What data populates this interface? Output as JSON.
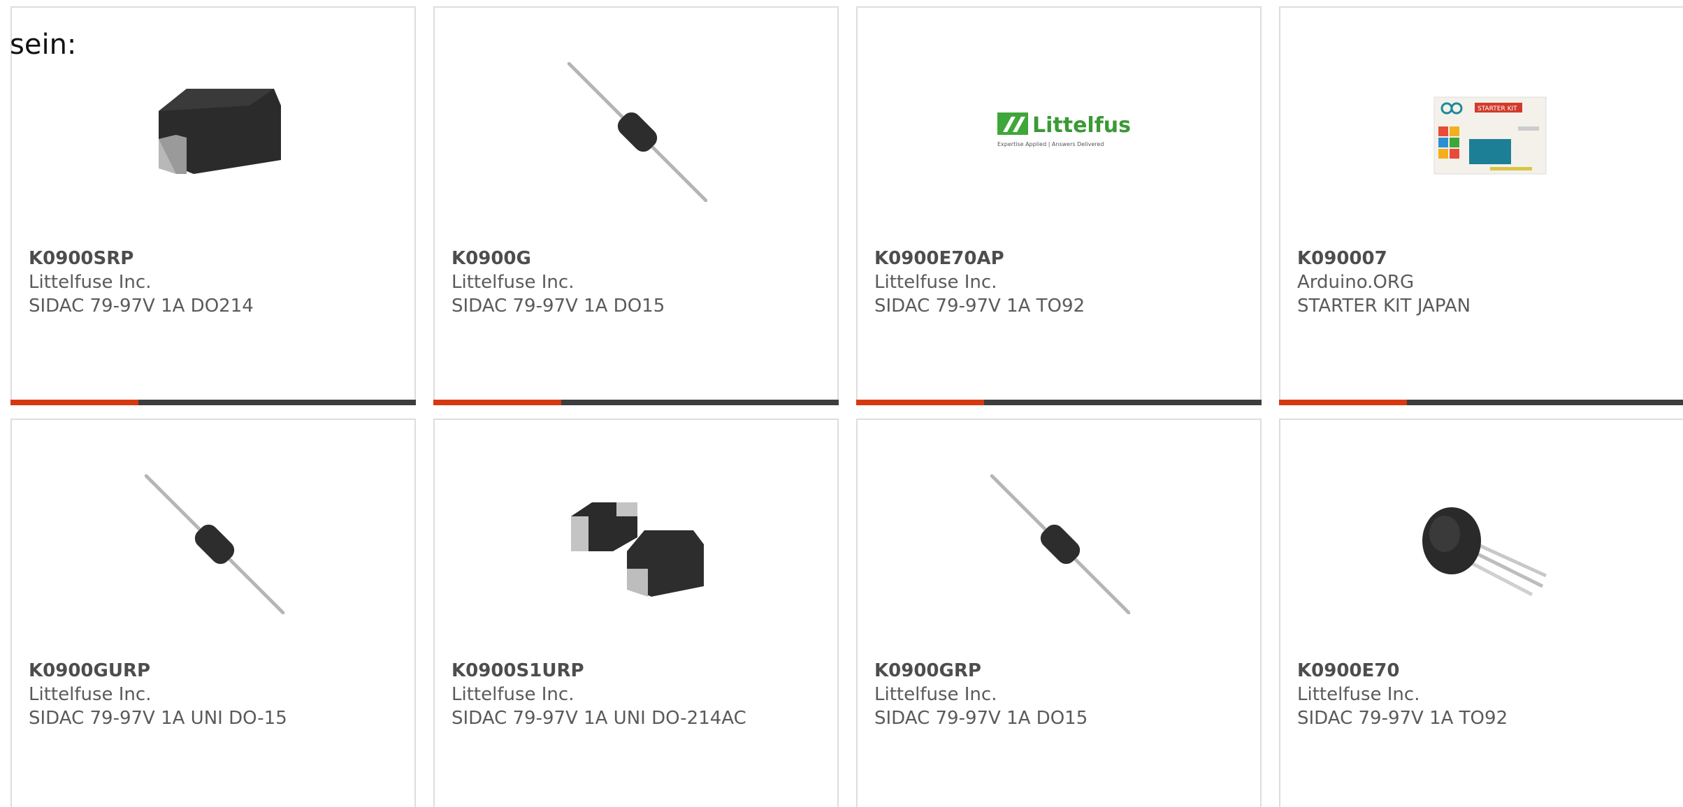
{
  "intro_text": "sein:",
  "accent_color": "#d6390f",
  "bar_color": "#3d3d3d",
  "products": [
    {
      "part": "K0900SRP",
      "manufacturer": "Littelfuse Inc.",
      "description": "SIDAC 79-97V 1A DO214",
      "image": "do214-package-image"
    },
    {
      "part": "K0900G",
      "manufacturer": "Littelfuse Inc.",
      "description": "SIDAC 79-97V 1A DO15",
      "image": "axial-diode-image"
    },
    {
      "part": "K0900E70AP",
      "manufacturer": "Littelfuse Inc.",
      "description": "SIDAC 79-97V 1A TO92",
      "image": "littelfuse-logo-image",
      "logo_text": "Littelfuse",
      "logo_tagline": "Expertise Applied | Answers Delivered"
    },
    {
      "part": "K090007",
      "manufacturer": "Arduino.ORG",
      "description": "STARTER KIT JAPAN",
      "image": "arduino-starter-kit-image",
      "logo_text": "STARTER KIT"
    },
    {
      "part": "K0900GURP",
      "manufacturer": "Littelfuse Inc.",
      "description": "SIDAC 79-97V 1A UNI DO-15",
      "image": "axial-diode-image"
    },
    {
      "part": "K0900S1URP",
      "manufacturer": "Littelfuse Inc.",
      "description": "SIDAC 79-97V 1A UNI DO-214AC",
      "image": "smd-diode-pair-image"
    },
    {
      "part": "K0900GRP",
      "manufacturer": "Littelfuse Inc.",
      "description": "SIDAC 79-97V 1A DO15",
      "image": "axial-diode-image"
    },
    {
      "part": "K0900E70",
      "manufacturer": "Littelfuse Inc.",
      "description": "SIDAC 79-97V 1A TO92",
      "image": "to92-transistor-image"
    }
  ]
}
